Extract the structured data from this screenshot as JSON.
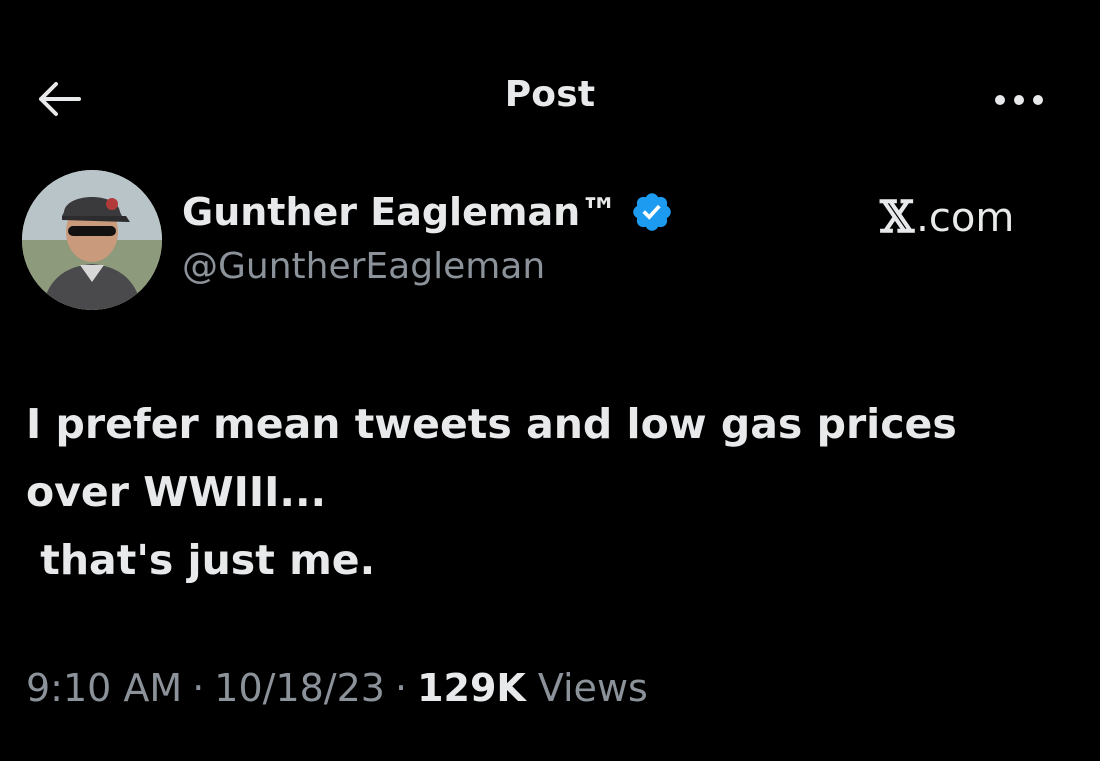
{
  "header": {
    "title": "Post",
    "back_icon": "arrow-left-icon",
    "more_icon": "more-horizontal-icon"
  },
  "author": {
    "name": "Gunther Eagleman™",
    "handle": "@GuntherEagleman",
    "verified_icon": "verified-badge-icon",
    "verified_color": "#1d9bf0"
  },
  "watermark": {
    "glyph": "𝕏",
    "text": ".com"
  },
  "tweet": {
    "lines": [
      "I prefer mean tweets and low gas prices",
      "over WWIII...",
      " that's just me."
    ]
  },
  "meta": {
    "time": "9:10 AM",
    "separator": "·",
    "date": "10/18/23",
    "views_count": "129K",
    "views_label": "Views"
  },
  "colors": {
    "background": "#000000",
    "primary_text": "#e7e9ea",
    "secondary_text": "#8b9299",
    "accent": "#1d9bf0"
  }
}
